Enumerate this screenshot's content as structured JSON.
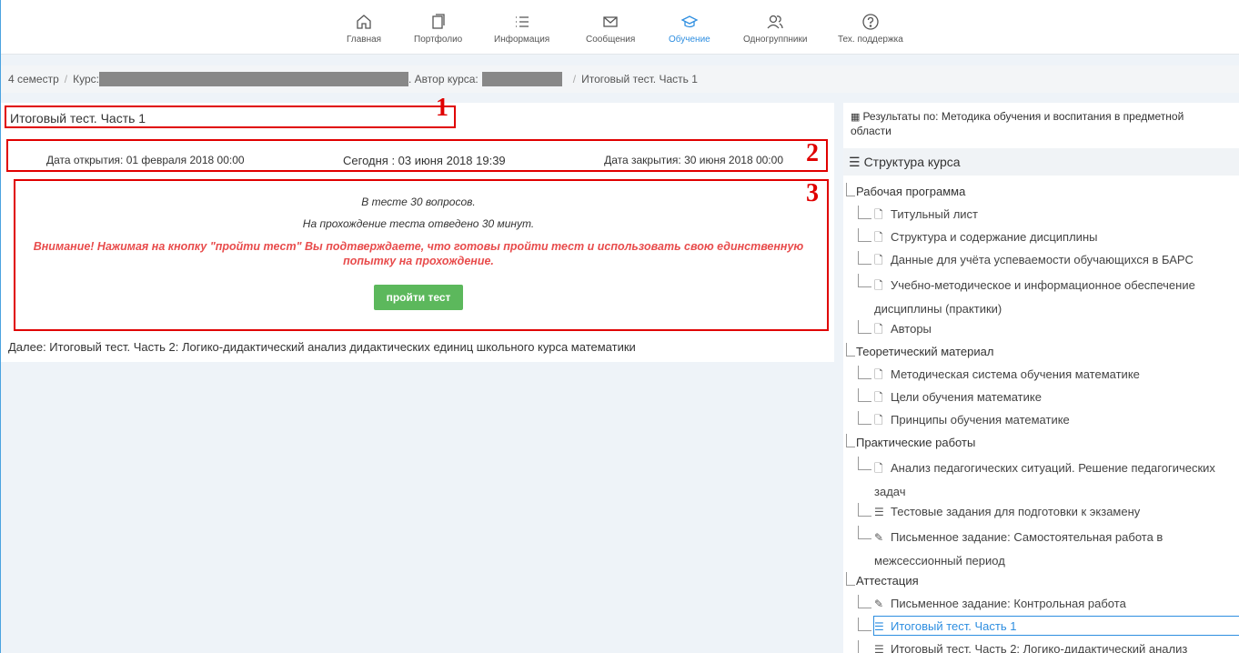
{
  "nav": [
    {
      "label": "Главная",
      "icon": "home-icon"
    },
    {
      "label": "Портфолио",
      "icon": "portfolio-icon"
    },
    {
      "label": "Информация",
      "icon": "list-icon"
    },
    {
      "label": "Сообщения",
      "icon": "envelope-icon"
    },
    {
      "label": "Обучение",
      "icon": "graduation-cap-icon",
      "active": true
    },
    {
      "label": "Одногруппники",
      "icon": "users-icon"
    },
    {
      "label": "Тех. поддержка",
      "icon": "question-icon"
    }
  ],
  "breadcrumb": {
    "semester": "4 семестр",
    "sep": "/",
    "course_label": "Курс:",
    "author_label": ". Автор курса:",
    "current": "Итоговый тест. Часть 1"
  },
  "test": {
    "title": "Итоговый тест. Часть 1",
    "open_date": "Дата открытия: 01 февраля 2018 00:00",
    "today": "Сегодня :  03 июня 2018 19:39",
    "close_date": "Дата закрытия: 30 июня 2018 00:00",
    "questions": "В тесте 30 вопросов.",
    "time": "На прохождение теста отведено  30  минут.",
    "warning": "Внимание! Нажимая на кнопку \"пройти тест\" Вы подтверждаете, что готовы пройти тест и использовать свою единственную попытку на прохождение.",
    "button": "пройти тест",
    "next": "Далее: Итоговый тест. Часть 2: Логико-дидактический анализ дидактических единиц школьного курса математики"
  },
  "annotations": [
    "1",
    "2",
    "3"
  ],
  "sidebar": {
    "results": "Результаты по: Методика обучения и воспитания в предметной области",
    "structure_title": "Структура курса",
    "sections": [
      {
        "title": "Рабочая программа",
        "items": [
          {
            "label": "Титульный лист",
            "icon": "📄"
          },
          {
            "label": "Структура и содержание дисциплины",
            "icon": "📄"
          },
          {
            "label": "Данные для учёта успеваемости обучающихся в БАРС",
            "icon": "📄"
          },
          {
            "label": "Учебно-методическое и информационное обеспечение дисциплины (практики)",
            "icon": "📄"
          },
          {
            "label": "Авторы",
            "icon": "📄"
          }
        ]
      },
      {
        "title": "Теоретический материал",
        "items": [
          {
            "label": "Методическая система обучения математике",
            "icon": "📄"
          },
          {
            "label": "Цели обучения математике",
            "icon": "📄"
          },
          {
            "label": "Принципы обучения математике",
            "icon": "📄"
          }
        ]
      },
      {
        "title": "Практические работы",
        "items": [
          {
            "label": "Анализ педагогических ситуаций. Решение педагогических задач",
            "icon": "📄"
          },
          {
            "label": "Тестовые задания для подготовки к экзамену",
            "icon": "☰"
          },
          {
            "label": "Письменное задание: Самостоятельная работа в межсессионный период",
            "icon": "✎"
          }
        ]
      },
      {
        "title": "Аттестация",
        "items": [
          {
            "label": "Письменное задание: Контрольная работа",
            "icon": "✎"
          },
          {
            "label": "Итоговый тест. Часть 1",
            "icon": "☰",
            "active": true
          },
          {
            "label": "Итоговый тест. Часть 2: Логико-дидактический анализ",
            "icon": "☰"
          }
        ]
      }
    ]
  }
}
